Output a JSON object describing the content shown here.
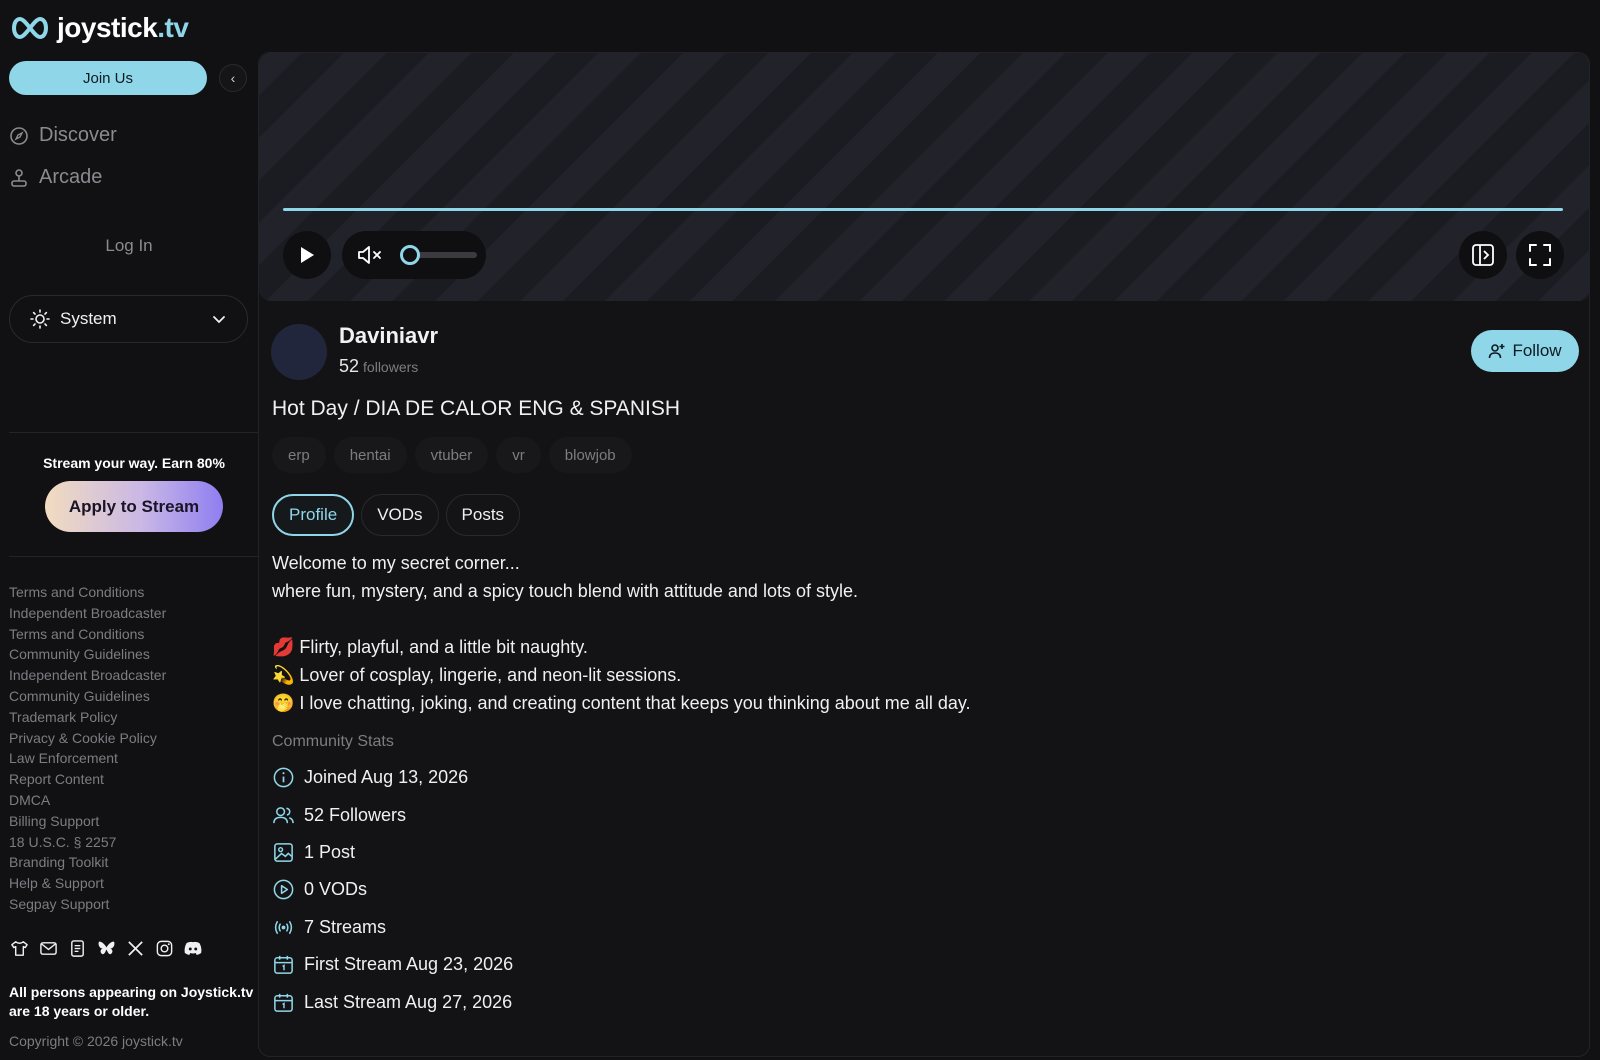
{
  "brand": {
    "name": "joystick",
    "tld": ".tv",
    "accent": "#8fd6e8"
  },
  "sidebar": {
    "join_label": "Join Us",
    "nav": [
      {
        "label": "Discover",
        "icon": "compass-icon"
      },
      {
        "label": "Arcade",
        "icon": "joystick-icon"
      }
    ],
    "login_label": "Log In",
    "theme": {
      "label": "System",
      "icon": "sun-icon"
    },
    "promo_text": "Stream your way. Earn 80%",
    "apply_label": "Apply to Stream",
    "footer_links": [
      "Terms and Conditions",
      "Independent Broadcaster",
      "Terms and Conditions",
      "Community Guidelines",
      "Independent Broadcaster",
      "Community Guidelines",
      "Trademark Policy",
      "Privacy & Cookie Policy",
      "Law Enforcement",
      "Report Content",
      "DMCA",
      "Billing Support",
      "18 U.S.C. § 2257",
      "Branding Toolkit",
      "Help & Support",
      "Segpay Support"
    ],
    "socials": [
      "tshirt-icon",
      "mail-icon",
      "document-icon",
      "bluesky-icon",
      "x-icon",
      "instagram-icon",
      "discord-icon"
    ],
    "age_note": "All persons appearing on Joystick.tv are 18 years or older.",
    "copyright": "Copyright © 2026 joystick.tv"
  },
  "player": {
    "progress_percent": 100,
    "volume_percent": 0,
    "muted": true
  },
  "channel": {
    "name": "Daviniavr",
    "follower_count": "52",
    "followers_label": "followers",
    "follow_label": "Follow",
    "title": "Hot Day / DIA DE CALOR ENG & SPANISH",
    "tags": [
      "erp",
      "hentai",
      "vtuber",
      "vr",
      "blowjob"
    ],
    "tabs": [
      "Profile",
      "VODs",
      "Posts"
    ],
    "active_tab": "Profile",
    "bio": [
      "Welcome to my secret corner...",
      "where fun, mystery, and a spicy touch blend with attitude and lots of style.",
      "",
      "💋 Flirty, playful, and a little bit naughty.",
      "💫 Lover of cosplay, lingerie, and neon-lit sessions.",
      "🤭 I love chatting, joking, and creating content that keeps you thinking about me all day."
    ],
    "stats_title": "Community Stats",
    "stats": [
      {
        "icon": "info-icon",
        "text": "Joined Aug 13, 2026"
      },
      {
        "icon": "users-icon",
        "text": "52 Followers"
      },
      {
        "icon": "image-icon",
        "text": "1 Post"
      },
      {
        "icon": "play-circle-icon",
        "text": "0 VODs"
      },
      {
        "icon": "broadcast-icon",
        "text": "7 Streams"
      },
      {
        "icon": "calendar-icon",
        "text": "First Stream Aug 23, 2026"
      },
      {
        "icon": "calendar-icon",
        "text": "Last Stream Aug 27, 2026"
      }
    ]
  }
}
